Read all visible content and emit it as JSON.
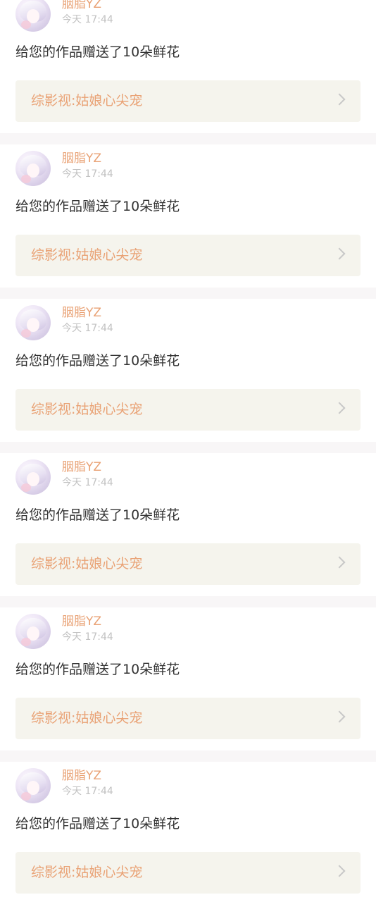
{
  "notifications": [
    {
      "user_name": "胭脂YZ",
      "time": "今天 17:44",
      "message": "给您的作品赠送了10朵鲜花",
      "work_title": "综影视:姑娘心尖宠",
      "avatar_icon": "user-avatar-icon",
      "chevron_icon": "chevron-right-icon"
    },
    {
      "user_name": "胭脂YZ",
      "time": "今天 17:44",
      "message": "给您的作品赠送了10朵鲜花",
      "work_title": "综影视:姑娘心尖宠",
      "avatar_icon": "user-avatar-icon",
      "chevron_icon": "chevron-right-icon"
    },
    {
      "user_name": "胭脂YZ",
      "time": "今天 17:44",
      "message": "给您的作品赠送了10朵鲜花",
      "work_title": "综影视:姑娘心尖宠",
      "avatar_icon": "user-avatar-icon",
      "chevron_icon": "chevron-right-icon"
    },
    {
      "user_name": "胭脂YZ",
      "time": "今天 17:44",
      "message": "给您的作品赠送了10朵鲜花",
      "work_title": "综影视:姑娘心尖宠",
      "avatar_icon": "user-avatar-icon",
      "chevron_icon": "chevron-right-icon"
    },
    {
      "user_name": "胭脂YZ",
      "time": "今天 17:44",
      "message": "给您的作品赠送了10朵鲜花",
      "work_title": "综影视:姑娘心尖宠",
      "avatar_icon": "user-avatar-icon",
      "chevron_icon": "chevron-right-icon"
    },
    {
      "user_name": "胭脂YZ",
      "time": "今天 17:44",
      "message": "给您的作品赠送了10朵鲜花",
      "work_title": "综影视:姑娘心尖宠",
      "avatar_icon": "user-avatar-icon",
      "chevron_icon": "chevron-right-icon"
    }
  ],
  "colors": {
    "accent": "#e9a275",
    "text": "#333333",
    "muted": "#c2c2c2",
    "card_link_bg": "#f5f4ed",
    "separator": "#f8f6f7"
  }
}
